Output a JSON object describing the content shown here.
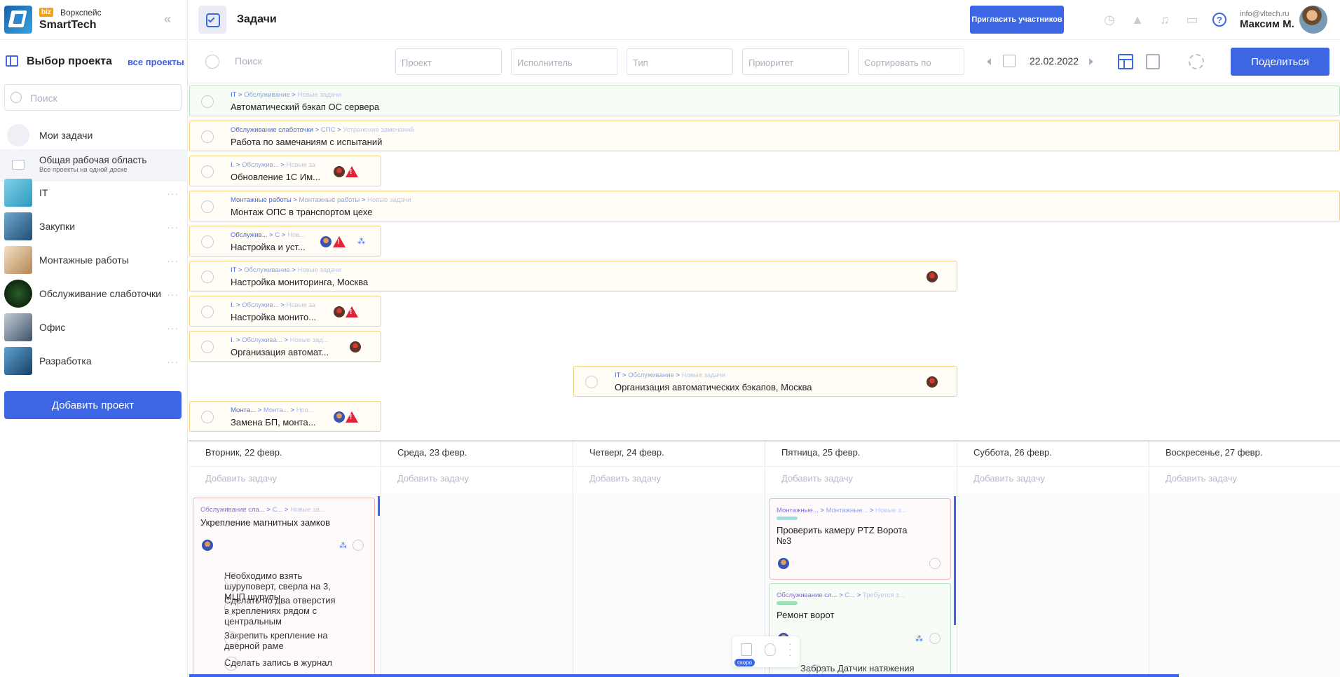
{
  "sidebar": {
    "badge": "biz",
    "workspace_label": "Воркспейс",
    "workspace_name": "SmartTech",
    "section_title": "Выбор проекта",
    "all_projects_link": "все проекты",
    "search_placeholder": "Поиск",
    "my_tasks": "Мои задачи",
    "shared_area": {
      "title": "Общая рабочая область",
      "subtitle": "Все проекты на одной доске"
    },
    "projects": [
      {
        "label": "IT",
        "color": "#4fb5d6"
      },
      {
        "label": "Закупки",
        "color": "#3a7fb0"
      },
      {
        "label": "Монтажные работы",
        "color": "#c9a06a"
      },
      {
        "label": "Обслуживание слаботочки",
        "color": "#0b2410"
      },
      {
        "label": "Офис",
        "color": "#5d7187"
      },
      {
        "label": "Разработка",
        "color": "#2c6a98"
      }
    ],
    "add_project_button": "Добавить проект"
  },
  "header": {
    "title": "Задачи",
    "invite_button": "Пригласить участников",
    "user_email": "info@vltech.ru",
    "user_name": "Максим М.",
    "icons": [
      "stopwatch-icon",
      "rocket-icon",
      "bell-icon",
      "chat-icon",
      "help-icon"
    ]
  },
  "filters": {
    "search_placeholder": "Поиск",
    "project": "Проект",
    "assignee": "Исполнитель",
    "type": "Тип",
    "priority": "Приоритет",
    "sort": "Сортировать по",
    "date": "22.02.2022",
    "share_button": "Поделиться"
  },
  "task_bars": [
    {
      "crumb": [
        "IT",
        "Обслуживание",
        "Новые задачи"
      ],
      "title": "Автоматический бэкап ОС сервера",
      "style": "green"
    },
    {
      "crumb": [
        "Обслуживание слаботочки",
        "СПС",
        "Устранение замечаний"
      ],
      "title": "Работа по замечаниям с испытаний",
      "style": "yellow"
    },
    {
      "crumb": [
        "I.",
        "Обслужив...",
        "Новые за"
      ],
      "title": "Обновление 1С Им...",
      "style": "yellow"
    },
    {
      "crumb": [
        "Монтажные работы",
        "Монтажные работы",
        "Новые задачи"
      ],
      "title": "Монтаж ОПС в транспортом цехе",
      "style": "yellow"
    },
    {
      "crumb": [
        "Обслужив...",
        "С",
        "Нов..."
      ],
      "title": "Настройка и уст...",
      "style": "yellow"
    },
    {
      "crumb": [
        "IT",
        "Обслуживание",
        "Новые задачи"
      ],
      "title": "Настройка мониторинга, Москва",
      "style": "yellow"
    },
    {
      "crumb": [
        "I.",
        "Обслужив...",
        "Новые за"
      ],
      "title": "Настройка монито...",
      "style": "yellow"
    },
    {
      "crumb": [
        "I.",
        "Обслужива...",
        "Новые зад..."
      ],
      "title": "Организация автомат...",
      "style": "yellow"
    },
    {
      "crumb": [
        "IT",
        "Обслуживание",
        "Новые задачи"
      ],
      "title": "Организация автоматических бэкапов, Москва",
      "style": "yellow"
    },
    {
      "crumb": [
        "Монта...",
        "Монта...",
        "Нов..."
      ],
      "title": "Замена БП, монта...",
      "style": "yellow"
    }
  ],
  "days": [
    {
      "label": "Вторник, 22 февр.",
      "add": "Добавить задачу"
    },
    {
      "label": "Среда, 23 февр.",
      "add": "Добавить задачу"
    },
    {
      "label": "Четверг, 24 февр.",
      "add": "Добавить задачу"
    },
    {
      "label": "Пятница, 25 февр.",
      "add": "Добавить задачу"
    },
    {
      "label": "Суббота, 26 февр.",
      "add": "Добавить задачу"
    },
    {
      "label": "Воскресенье, 27 февр.",
      "add": "Добавить задачу"
    }
  ],
  "cards": {
    "tuesday": {
      "crumb": [
        "Обслуживание сла...",
        "С...",
        "Новые за..."
      ],
      "title": "Укрепление магнитных замков",
      "subtasks": [
        "Необходимо взять шуруповерт, сверла на 3, МЦП шурупы",
        "Сделать по два отверстия в креплениях рядом с центральным",
        "Закрепить крепление на дверной раме",
        "Сделать запись в журнал"
      ]
    },
    "friday_1": {
      "crumb": [
        "Монтажные...",
        "Монтажные...",
        "Новые з..."
      ],
      "title": "Проверить камеру PTZ Ворота №3",
      "tag_color": "#9de0e6"
    },
    "friday_2": {
      "crumb": [
        "Обслуживание сл...",
        "С...",
        "Требуется з..."
      ],
      "title": "Ремонт ворот",
      "tag_color": "#9be0b3",
      "subtask": "Забрать Датчик натяжения"
    }
  },
  "floater": {
    "soon_badge": "скоро"
  }
}
